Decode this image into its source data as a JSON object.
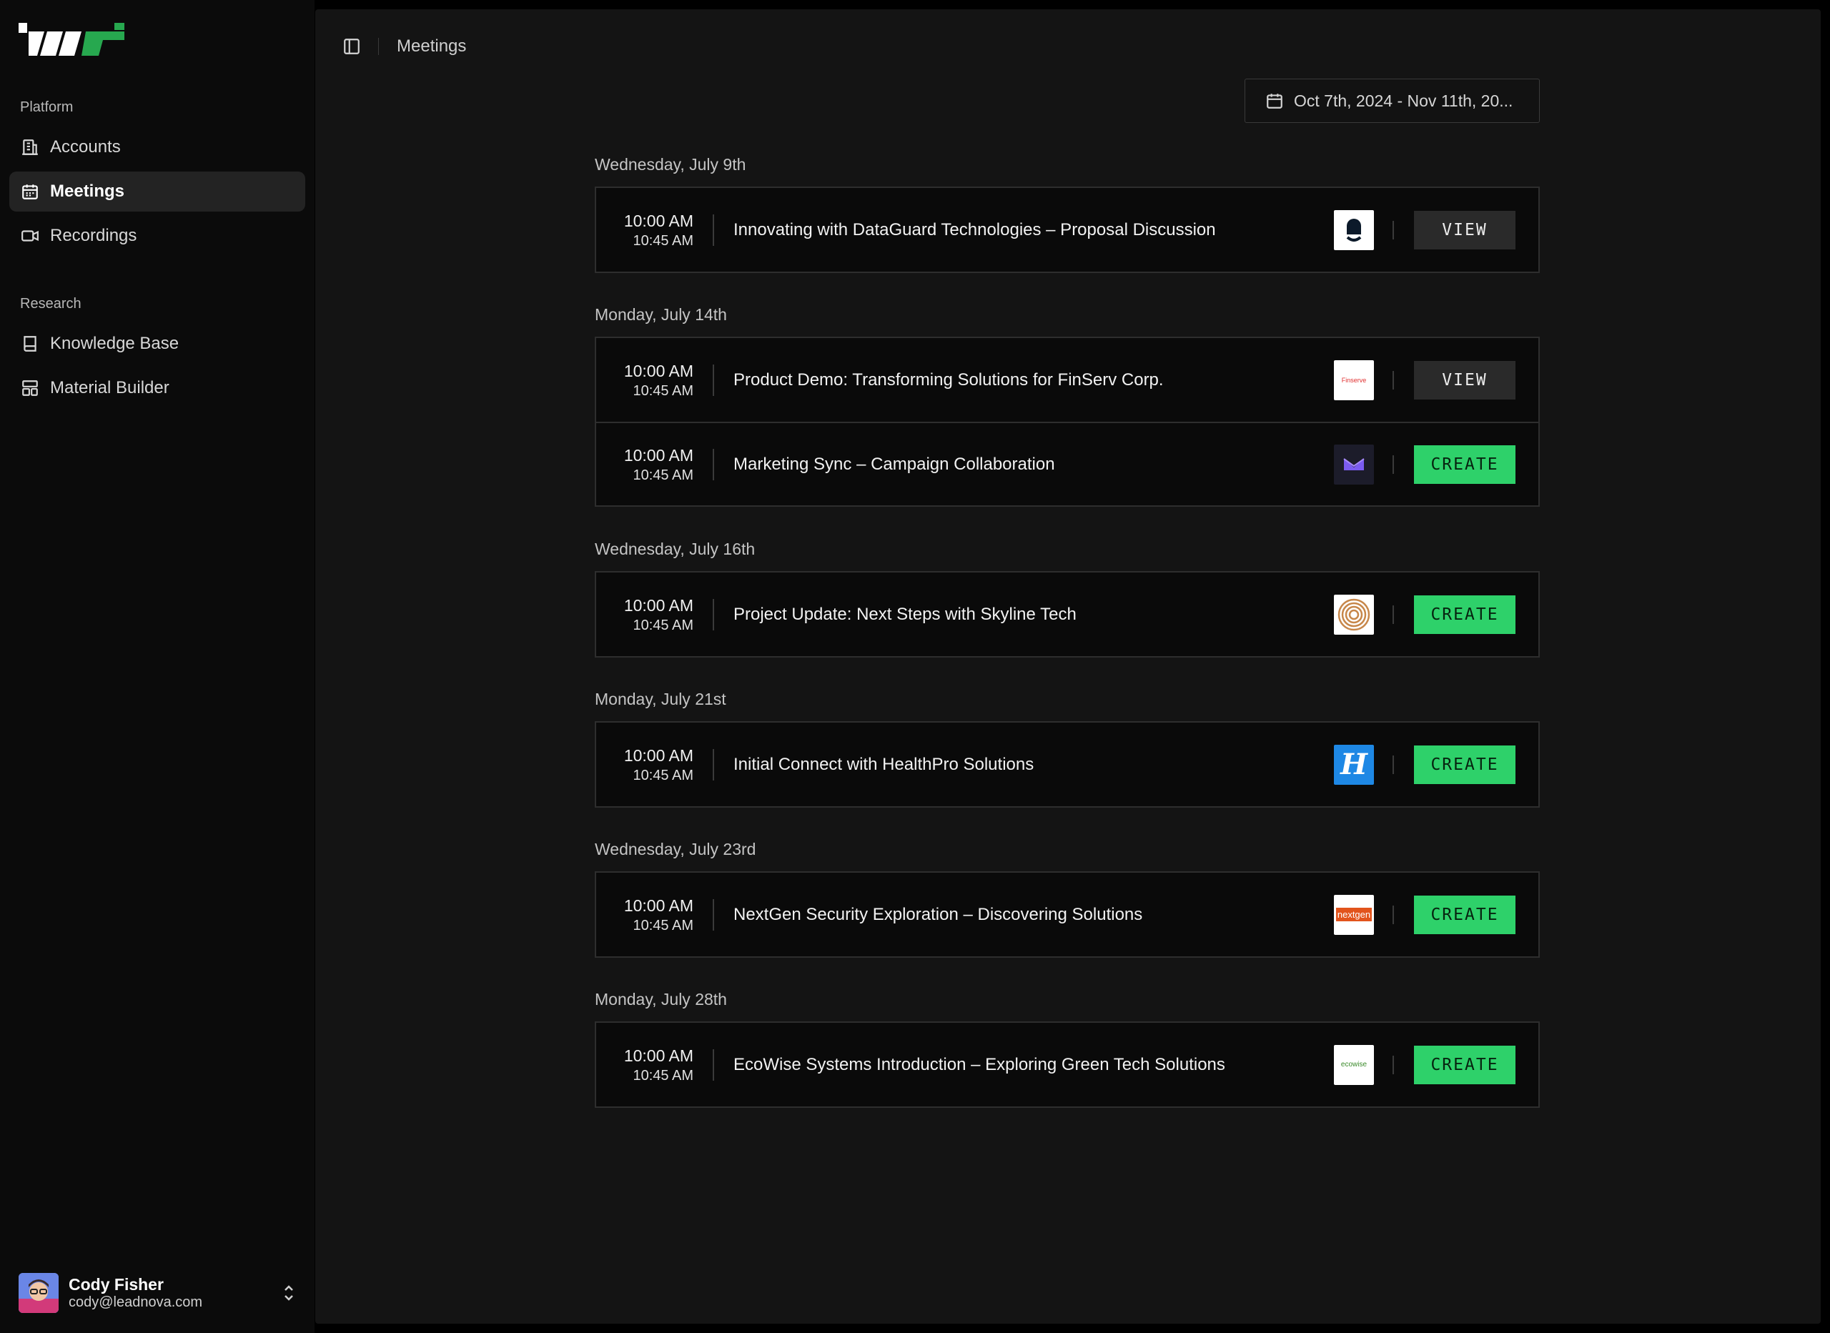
{
  "sidebar": {
    "sections": [
      {
        "label": "Platform",
        "items": [
          {
            "label": "Accounts",
            "icon": "building-icon",
            "active": false
          },
          {
            "label": "Meetings",
            "icon": "calendar-icon",
            "active": true
          },
          {
            "label": "Recordings",
            "icon": "video-icon",
            "active": false
          }
        ]
      },
      {
        "label": "Research",
        "items": [
          {
            "label": "Knowledge Base",
            "icon": "book-icon",
            "active": false
          },
          {
            "label": "Material Builder",
            "icon": "layout-icon",
            "active": false
          }
        ]
      }
    ],
    "user": {
      "name": "Cody Fisher",
      "email": "cody@leadnova.com"
    }
  },
  "header": {
    "breadcrumb": "Meetings"
  },
  "date_range": "Oct 7th, 2024 - Nov 11th, 20...",
  "colors": {
    "accent": "#2ed16a",
    "background": "#141414",
    "sidebar": "#0b0b0b"
  },
  "days": [
    {
      "label": "Wednesday, July 9th",
      "meetings": [
        {
          "start": "10:00 AM",
          "end": "10:45 AM",
          "title": "Innovating with DataGuard Technologies – Proposal Discussion",
          "company_logo": "dataguard-logo",
          "action": "VIEW"
        }
      ]
    },
    {
      "label": "Monday, July 14th",
      "meetings": [
        {
          "start": "10:00 AM",
          "end": "10:45 AM",
          "title": "Product Demo: Transforming Solutions for FinServ Corp.",
          "company_logo": "finserve-logo",
          "logo_text": "Finserve",
          "action": "VIEW"
        },
        {
          "start": "10:00 AM",
          "end": "10:45 AM",
          "title": "Marketing Sync – Campaign Collaboration",
          "company_logo": "envelope-logo",
          "action": "CREATE"
        }
      ]
    },
    {
      "label": "Wednesday, July 16th",
      "meetings": [
        {
          "start": "10:00 AM",
          "end": "10:45 AM",
          "title": "Project Update: Next Steps with Skyline Tech",
          "company_logo": "skyline-logo",
          "action": "CREATE"
        }
      ]
    },
    {
      "label": "Monday, July 21st",
      "meetings": [
        {
          "start": "10:00 AM",
          "end": "10:45 AM",
          "title": "Initial Connect with HealthPro Solutions",
          "company_logo": "healthpro-logo",
          "logo_text": "H",
          "action": "CREATE"
        }
      ]
    },
    {
      "label": "Wednesday, July 23rd",
      "meetings": [
        {
          "start": "10:00 AM",
          "end": "10:45 AM",
          "title": "NextGen Security Exploration – Discovering Solutions",
          "company_logo": "nextgen-logo",
          "logo_text": "nextgen",
          "action": "CREATE"
        }
      ]
    },
    {
      "label": "Monday, July 28th",
      "meetings": [
        {
          "start": "10:00 AM",
          "end": "10:45 AM",
          "title": "EcoWise Systems Introduction – Exploring Green Tech Solutions",
          "company_logo": "ecowise-logo",
          "logo_text": "ecowise",
          "action": "CREATE"
        }
      ]
    }
  ]
}
